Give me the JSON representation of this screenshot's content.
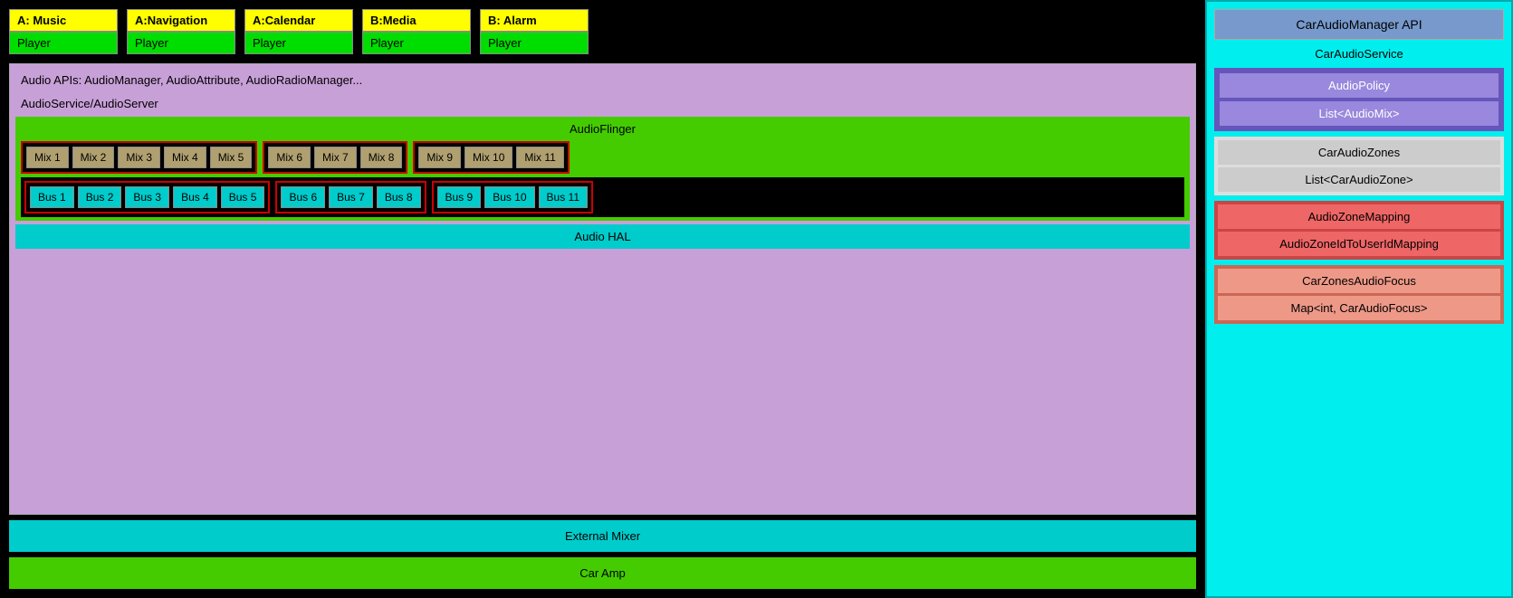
{
  "players": [
    {
      "top": "A: Music",
      "bottom": "Player"
    },
    {
      "top": "A:Navigation",
      "bottom": "Player"
    },
    {
      "top": "A:Calendar",
      "bottom": "Player"
    },
    {
      "top": "B:Media",
      "bottom": "Player"
    },
    {
      "top": "B: Alarm",
      "bottom": "Player"
    }
  ],
  "audio_apis_label": "Audio APIs: AudioManager, AudioAttribute, AudioRadioManager...",
  "audioservice_label": "AudioService/AudioServer",
  "audioflinger_label": "AudioFlinger",
  "mix_groups": [
    [
      "Mix 1",
      "Mix 2",
      "Mix 3",
      "Mix 4",
      "Mix 5"
    ],
    [
      "Mix 6",
      "Mix 7",
      "Mix 8"
    ],
    [
      "Mix 9",
      "Mix 10",
      "Mix 11"
    ]
  ],
  "bus_groups": [
    [
      "Bus 1",
      "Bus 2",
      "Bus 3",
      "Bus 4",
      "Bus 5"
    ],
    [
      "Bus 6",
      "Bus 7",
      "Bus 8"
    ],
    [
      "Bus 9",
      "Bus 10",
      "Bus 11"
    ]
  ],
  "audio_hal_label": "Audio HAL",
  "external_mixer_label": "External Mixer",
  "car_amp_label": "Car Amp",
  "right_panel": {
    "caraudiomanager_api": "CarAudioManager API",
    "caraudioservice_label": "CarAudioService",
    "audiopolicy_label": "AudioPolicy",
    "list_audiomix_label": "List<AudioMix>",
    "caraudiozones_label": "CarAudioZones",
    "list_caraudiozone_label": "List<CarAudioZone>",
    "audiozone_mapping_label": "AudioZoneMapping",
    "audiozoneid_userid_label": "AudioZoneIdToUserIdMapping",
    "carzones_audiofocus_label": "CarZonesAudioFocus",
    "map_caraudiofocus_label": "Map<int, CarAudioFocus>"
  }
}
